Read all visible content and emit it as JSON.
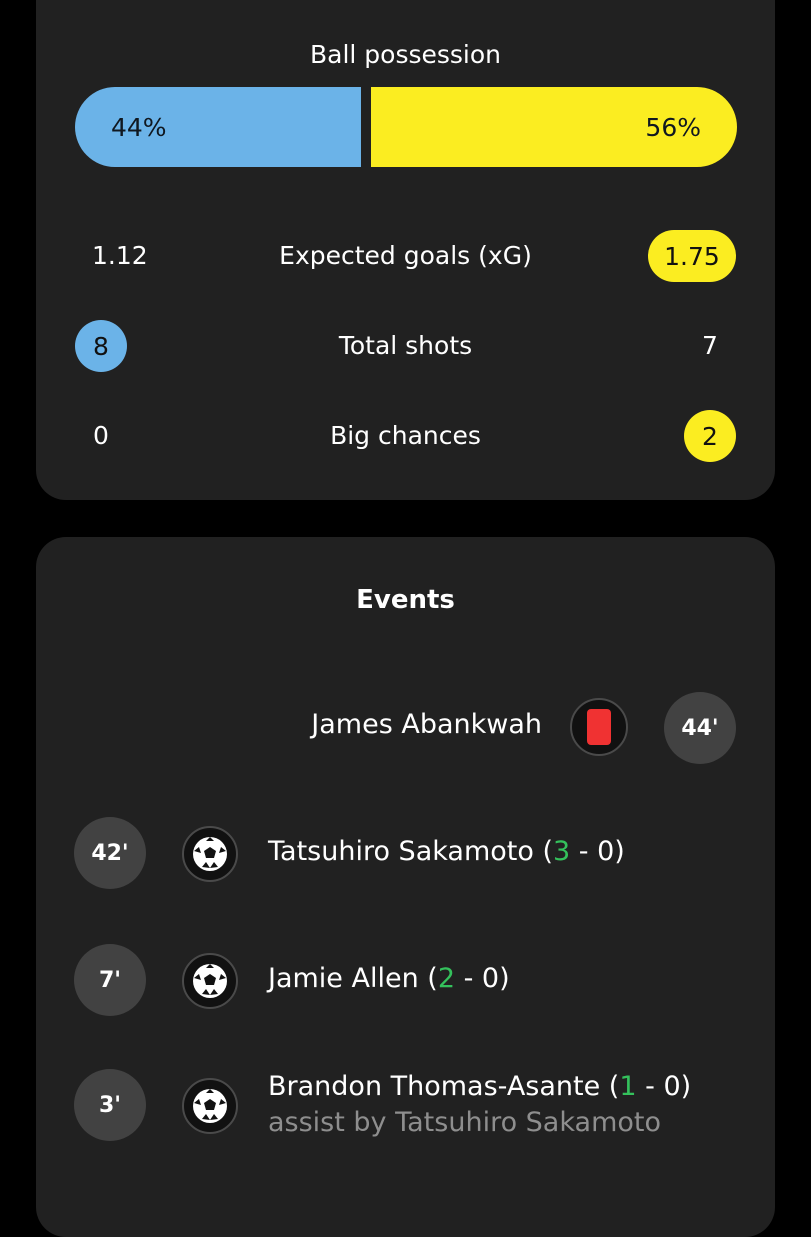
{
  "stats": {
    "possession": {
      "title": "Ball possession",
      "home": "44%",
      "away": "56%",
      "home_fraction": 0.44
    },
    "rows": [
      {
        "label": "Expected goals (xG)",
        "home": "1.12",
        "away": "1.75"
      },
      {
        "label": "Total shots",
        "home": "8",
        "away": "7"
      },
      {
        "label": "Big chances",
        "home": "0",
        "away": "2"
      }
    ],
    "colors": {
      "home": "#6bb3e8",
      "away": "#fbed21",
      "card": "#212121",
      "score_highlight": "#34c15c"
    }
  },
  "events": {
    "title": "Events",
    "items": [
      {
        "minute": "44'",
        "player": "James Abankwah",
        "icon": "red-card-icon",
        "side": "away"
      },
      {
        "minute": "42'",
        "player": "Tatsuhiro Sakamoto",
        "score_open": " (",
        "score_home": "3",
        "score_rest": " - 0)",
        "icon": "football-icon",
        "side": "home"
      },
      {
        "minute": "7'",
        "player": "Jamie Allen",
        "score_open": " (",
        "score_home": "2",
        "score_rest": " - 0)",
        "icon": "football-icon",
        "side": "home"
      },
      {
        "minute": "3'",
        "player": "Brandon Thomas-Asante",
        "score_open": " (",
        "score_home": "1",
        "score_rest": " - 0)",
        "assist": "assist by Tatsuhiro Sakamoto",
        "icon": "football-icon",
        "side": "home"
      }
    ]
  }
}
